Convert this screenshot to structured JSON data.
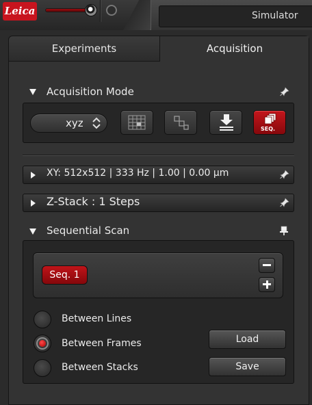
{
  "titlebar": {
    "logo": "Leica",
    "app_title": "Simulator"
  },
  "tabs": [
    {
      "label": "Experiments"
    },
    {
      "label": "Acquisition"
    }
  ],
  "acquisition_mode": {
    "title": "Acquisition Mode",
    "scan_mode": "xyz",
    "seq_button_label": "SEQ."
  },
  "xy_row": {
    "label": "XY: 512x512 | 333 Hz | 1.00 | 0.00 µm"
  },
  "zstack_row": {
    "label": "Z-Stack :  1 Steps"
  },
  "sequential_scan": {
    "title": "Sequential Scan",
    "sequences": [
      "Seq. 1"
    ],
    "options": [
      {
        "label": "Between Lines",
        "selected": false
      },
      {
        "label": "Between Frames",
        "selected": true
      },
      {
        "label": "Between Stacks",
        "selected": false
      }
    ],
    "load_label": "Load",
    "save_label": "Save"
  },
  "colors": {
    "accent_red": "#c4161c",
    "panel_bg": "#333333"
  }
}
